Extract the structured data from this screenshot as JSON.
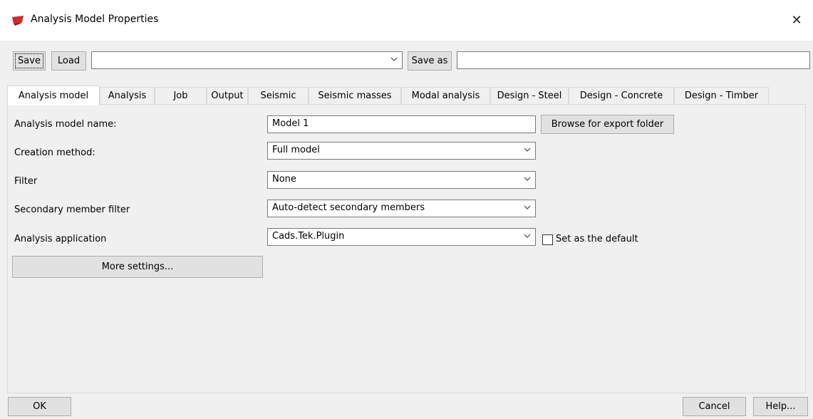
{
  "window": {
    "title": "Analysis Model Properties",
    "app_icon": "tekla-logo-icon",
    "close_glyph": "✕"
  },
  "toolbar": {
    "save_label": "Save",
    "load_label": "Load",
    "preset_value": "",
    "save_as_label": "Save as",
    "save_as_value": ""
  },
  "tabs": [
    {
      "label": "Analysis model",
      "active": true
    },
    {
      "label": "Analysis"
    },
    {
      "label": "Job"
    },
    {
      "label": "Output"
    },
    {
      "label": "Seismic"
    },
    {
      "label": "Seismic masses"
    },
    {
      "label": "Modal analysis"
    },
    {
      "label": "Design - Steel"
    },
    {
      "label": "Design - Concrete"
    },
    {
      "label": "Design - Timber"
    }
  ],
  "form": {
    "model_name_label": "Analysis model name:",
    "model_name_value": "Model 1",
    "browse_label": "Browse for export folder",
    "creation_method_label": "Creation method:",
    "creation_method_value": "Full model",
    "filter_label": "Filter",
    "filter_value": "None",
    "secondary_filter_label": "Secondary member filter",
    "secondary_filter_value": "Auto-detect secondary members",
    "analysis_app_label": "Analysis application",
    "analysis_app_value": "Cads.Tek.Plugin",
    "set_default_label": "Set as the default",
    "set_default_checked": false,
    "more_settings_label": "More settings..."
  },
  "footer": {
    "ok_label": "OK",
    "cancel_label": "Cancel",
    "help_label": "Help..."
  },
  "colors": {
    "window_bg": "#f0f0f0",
    "titlebar_bg": "#ffffff",
    "button_bg": "#e1e1e1",
    "logo_red": "#d12b2b"
  }
}
